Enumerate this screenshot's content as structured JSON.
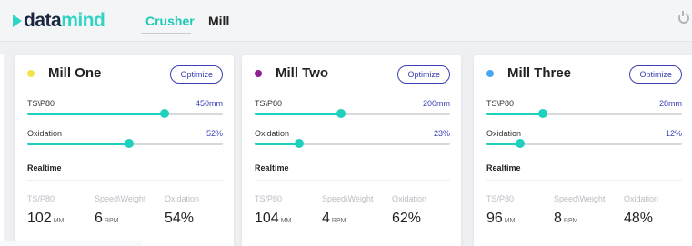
{
  "app": {
    "logo_main": "data",
    "logo_accent": "mind"
  },
  "nav": {
    "tabs": [
      {
        "label": "Crusher",
        "active": true
      },
      {
        "label": "Mill",
        "active": false
      }
    ],
    "power_icon": "power-icon"
  },
  "colors": {
    "accent": "#1ed1bd",
    "link": "#3a3fb5"
  },
  "cards": [
    {
      "title": "Mill One",
      "dot_color": "#f2e34b",
      "optimize_label": "Optimize",
      "ts_label": "TS\\P80",
      "ts_value": "450mm",
      "ts_level": 0.7,
      "ox_label": "Oxidation",
      "ox_value": "52%",
      "ox_level": 0.52,
      "realtime_label": "Realtime",
      "rt": [
        {
          "head": "TS/P80",
          "value": "102",
          "unit": "MM"
        },
        {
          "head": "Speed\\Weight",
          "value": "6",
          "unit": "RPM"
        },
        {
          "head": "Oxidation",
          "value": "54%",
          "unit": ""
        }
      ]
    },
    {
      "title": "Mill Two",
      "dot_color": "#8b1f8f",
      "optimize_label": "Optimize",
      "ts_label": "TS\\P80",
      "ts_value": "200mm",
      "ts_level": 0.44,
      "ox_label": "Oxidation",
      "ox_value": "23%",
      "ox_level": 0.23,
      "realtime_label": "Realtime",
      "rt": [
        {
          "head": "TS/P80",
          "value": "104",
          "unit": "MM"
        },
        {
          "head": "Speed\\Weight",
          "value": "4",
          "unit": "RPM"
        },
        {
          "head": "Oxidation",
          "value": "62%",
          "unit": ""
        }
      ]
    },
    {
      "title": "Mill Three",
      "dot_color": "#4aa6f0",
      "optimize_label": "Optimize",
      "ts_label": "TS\\P80",
      "ts_value": "28mm",
      "ts_level": 0.29,
      "ox_label": "Oxidation",
      "ox_value": "12%",
      "ox_level": 0.17,
      "realtime_label": "Realtime",
      "rt": [
        {
          "head": "TS/P80",
          "value": "96",
          "unit": "MM"
        },
        {
          "head": "Speed\\Weight",
          "value": "8",
          "unit": "RPM"
        },
        {
          "head": "Oxidation",
          "value": "48%",
          "unit": ""
        }
      ]
    }
  ]
}
